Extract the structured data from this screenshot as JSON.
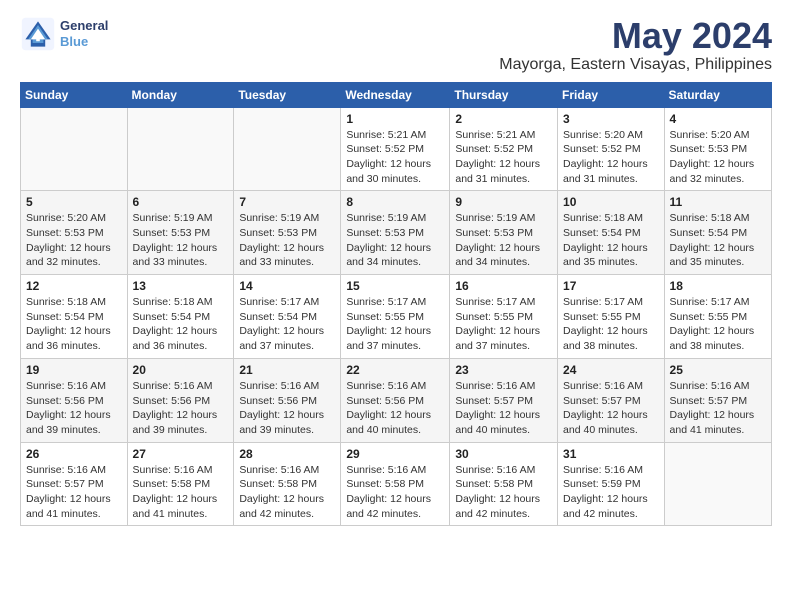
{
  "header": {
    "logo_line1": "General",
    "logo_line2": "Blue",
    "month": "May 2024",
    "location": "Mayorga, Eastern Visayas, Philippines"
  },
  "weekdays": [
    "Sunday",
    "Monday",
    "Tuesday",
    "Wednesday",
    "Thursday",
    "Friday",
    "Saturday"
  ],
  "weeks": [
    [
      {
        "day": "",
        "sunrise": "",
        "sunset": "",
        "daylight": ""
      },
      {
        "day": "",
        "sunrise": "",
        "sunset": "",
        "daylight": ""
      },
      {
        "day": "",
        "sunrise": "",
        "sunset": "",
        "daylight": ""
      },
      {
        "day": "1",
        "sunrise": "Sunrise: 5:21 AM",
        "sunset": "Sunset: 5:52 PM",
        "daylight": "Daylight: 12 hours and 30 minutes."
      },
      {
        "day": "2",
        "sunrise": "Sunrise: 5:21 AM",
        "sunset": "Sunset: 5:52 PM",
        "daylight": "Daylight: 12 hours and 31 minutes."
      },
      {
        "day": "3",
        "sunrise": "Sunrise: 5:20 AM",
        "sunset": "Sunset: 5:52 PM",
        "daylight": "Daylight: 12 hours and 31 minutes."
      },
      {
        "day": "4",
        "sunrise": "Sunrise: 5:20 AM",
        "sunset": "Sunset: 5:53 PM",
        "daylight": "Daylight: 12 hours and 32 minutes."
      }
    ],
    [
      {
        "day": "5",
        "sunrise": "Sunrise: 5:20 AM",
        "sunset": "Sunset: 5:53 PM",
        "daylight": "Daylight: 12 hours and 32 minutes."
      },
      {
        "day": "6",
        "sunrise": "Sunrise: 5:19 AM",
        "sunset": "Sunset: 5:53 PM",
        "daylight": "Daylight: 12 hours and 33 minutes."
      },
      {
        "day": "7",
        "sunrise": "Sunrise: 5:19 AM",
        "sunset": "Sunset: 5:53 PM",
        "daylight": "Daylight: 12 hours and 33 minutes."
      },
      {
        "day": "8",
        "sunrise": "Sunrise: 5:19 AM",
        "sunset": "Sunset: 5:53 PM",
        "daylight": "Daylight: 12 hours and 34 minutes."
      },
      {
        "day": "9",
        "sunrise": "Sunrise: 5:19 AM",
        "sunset": "Sunset: 5:53 PM",
        "daylight": "Daylight: 12 hours and 34 minutes."
      },
      {
        "day": "10",
        "sunrise": "Sunrise: 5:18 AM",
        "sunset": "Sunset: 5:54 PM",
        "daylight": "Daylight: 12 hours and 35 minutes."
      },
      {
        "day": "11",
        "sunrise": "Sunrise: 5:18 AM",
        "sunset": "Sunset: 5:54 PM",
        "daylight": "Daylight: 12 hours and 35 minutes."
      }
    ],
    [
      {
        "day": "12",
        "sunrise": "Sunrise: 5:18 AM",
        "sunset": "Sunset: 5:54 PM",
        "daylight": "Daylight: 12 hours and 36 minutes."
      },
      {
        "day": "13",
        "sunrise": "Sunrise: 5:18 AM",
        "sunset": "Sunset: 5:54 PM",
        "daylight": "Daylight: 12 hours and 36 minutes."
      },
      {
        "day": "14",
        "sunrise": "Sunrise: 5:17 AM",
        "sunset": "Sunset: 5:54 PM",
        "daylight": "Daylight: 12 hours and 37 minutes."
      },
      {
        "day": "15",
        "sunrise": "Sunrise: 5:17 AM",
        "sunset": "Sunset: 5:55 PM",
        "daylight": "Daylight: 12 hours and 37 minutes."
      },
      {
        "day": "16",
        "sunrise": "Sunrise: 5:17 AM",
        "sunset": "Sunset: 5:55 PM",
        "daylight": "Daylight: 12 hours and 37 minutes."
      },
      {
        "day": "17",
        "sunrise": "Sunrise: 5:17 AM",
        "sunset": "Sunset: 5:55 PM",
        "daylight": "Daylight: 12 hours and 38 minutes."
      },
      {
        "day": "18",
        "sunrise": "Sunrise: 5:17 AM",
        "sunset": "Sunset: 5:55 PM",
        "daylight": "Daylight: 12 hours and 38 minutes."
      }
    ],
    [
      {
        "day": "19",
        "sunrise": "Sunrise: 5:16 AM",
        "sunset": "Sunset: 5:56 PM",
        "daylight": "Daylight: 12 hours and 39 minutes."
      },
      {
        "day": "20",
        "sunrise": "Sunrise: 5:16 AM",
        "sunset": "Sunset: 5:56 PM",
        "daylight": "Daylight: 12 hours and 39 minutes."
      },
      {
        "day": "21",
        "sunrise": "Sunrise: 5:16 AM",
        "sunset": "Sunset: 5:56 PM",
        "daylight": "Daylight: 12 hours and 39 minutes."
      },
      {
        "day": "22",
        "sunrise": "Sunrise: 5:16 AM",
        "sunset": "Sunset: 5:56 PM",
        "daylight": "Daylight: 12 hours and 40 minutes."
      },
      {
        "day": "23",
        "sunrise": "Sunrise: 5:16 AM",
        "sunset": "Sunset: 5:57 PM",
        "daylight": "Daylight: 12 hours and 40 minutes."
      },
      {
        "day": "24",
        "sunrise": "Sunrise: 5:16 AM",
        "sunset": "Sunset: 5:57 PM",
        "daylight": "Daylight: 12 hours and 40 minutes."
      },
      {
        "day": "25",
        "sunrise": "Sunrise: 5:16 AM",
        "sunset": "Sunset: 5:57 PM",
        "daylight": "Daylight: 12 hours and 41 minutes."
      }
    ],
    [
      {
        "day": "26",
        "sunrise": "Sunrise: 5:16 AM",
        "sunset": "Sunset: 5:57 PM",
        "daylight": "Daylight: 12 hours and 41 minutes."
      },
      {
        "day": "27",
        "sunrise": "Sunrise: 5:16 AM",
        "sunset": "Sunset: 5:58 PM",
        "daylight": "Daylight: 12 hours and 41 minutes."
      },
      {
        "day": "28",
        "sunrise": "Sunrise: 5:16 AM",
        "sunset": "Sunset: 5:58 PM",
        "daylight": "Daylight: 12 hours and 42 minutes."
      },
      {
        "day": "29",
        "sunrise": "Sunrise: 5:16 AM",
        "sunset": "Sunset: 5:58 PM",
        "daylight": "Daylight: 12 hours and 42 minutes."
      },
      {
        "day": "30",
        "sunrise": "Sunrise: 5:16 AM",
        "sunset": "Sunset: 5:58 PM",
        "daylight": "Daylight: 12 hours and 42 minutes."
      },
      {
        "day": "31",
        "sunrise": "Sunrise: 5:16 AM",
        "sunset": "Sunset: 5:59 PM",
        "daylight": "Daylight: 12 hours and 42 minutes."
      },
      {
        "day": "",
        "sunrise": "",
        "sunset": "",
        "daylight": ""
      }
    ]
  ]
}
